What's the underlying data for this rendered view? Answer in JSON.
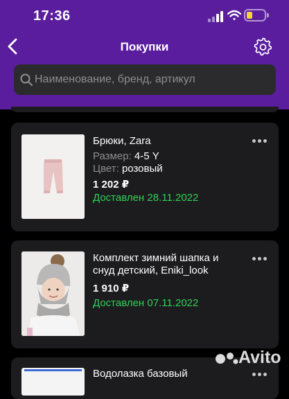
{
  "status_bar": {
    "time": "17:36"
  },
  "nav": {
    "title": "Покупки"
  },
  "search": {
    "placeholder": "Наименование, бренд, артикул"
  },
  "orders": [
    {
      "name": "Брюки, Zara",
      "size_label": "Размер:",
      "size_value": "4-5 Y",
      "color_label": "Цвет:",
      "color_value": "розовый",
      "price": "1 202 ₽",
      "status": "Доставлен 28.11.2022"
    },
    {
      "name_line1": "Комплект зимний шапка и",
      "name_line2": "снуд детский, Eniki_look",
      "price": "1 910 ₽",
      "status": "Доставлен 07.11.2022"
    },
    {
      "name": "Водолазка базовый"
    }
  ],
  "watermark": "Avito",
  "colors": {
    "header": "#5a1d9e",
    "card": "#1c1c1e",
    "delivered": "#30d158"
  }
}
